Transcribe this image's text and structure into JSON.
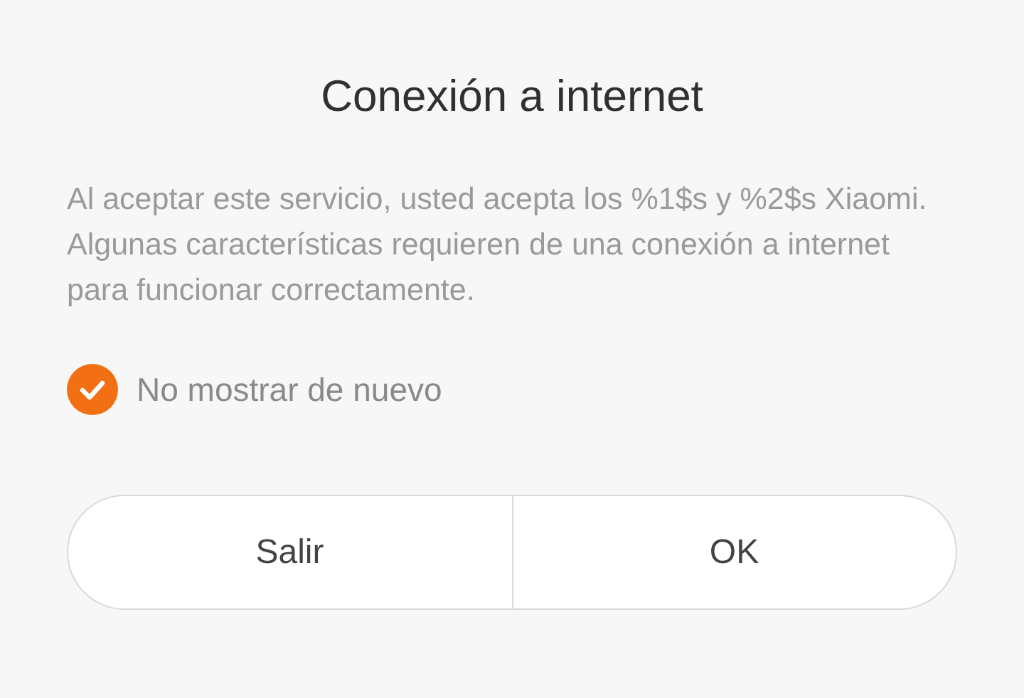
{
  "dialog": {
    "title": "Conexión a internet",
    "message": "Al aceptar este servicio, usted acepta los %1$s y %2$s Xiaomi. Algunas características requieren de una conexión a internet para funcionar correctamente.",
    "checkbox": {
      "label": "No mostrar de nuevo",
      "checked": true
    },
    "buttons": [
      "Salir",
      "OK"
    ]
  }
}
